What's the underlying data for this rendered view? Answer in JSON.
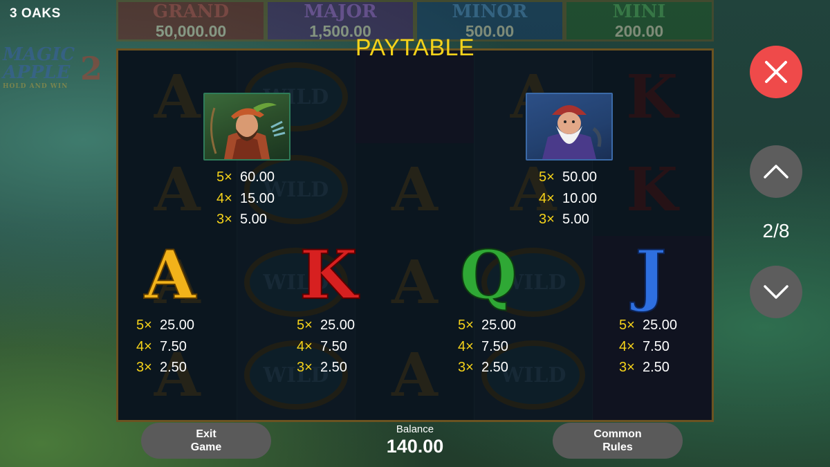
{
  "brand": "3 OAKS",
  "logo": {
    "line1": "MAGIC",
    "line2": "APPLE",
    "number": "2",
    "tagline": "HOLD AND WIN"
  },
  "jackpots": [
    {
      "name": "GRAND",
      "value": "50,000.00"
    },
    {
      "name": "MAJOR",
      "value": "1,500.00"
    },
    {
      "name": "MINOR",
      "value": "500.00"
    },
    {
      "name": "MINI",
      "value": "200.00"
    }
  ],
  "paytable": {
    "title": "PAYTABLE",
    "hunter": {
      "icon": "hunter-symbol-icon",
      "pays": [
        {
          "mult": "5×",
          "val": "60.00"
        },
        {
          "mult": "4×",
          "val": "15.00"
        },
        {
          "mult": "3×",
          "val": "5.00"
        }
      ]
    },
    "gnome": {
      "icon": "gnome-symbol-icon",
      "pays": [
        {
          "mult": "5×",
          "val": "50.00"
        },
        {
          "mult": "4×",
          "val": "10.00"
        },
        {
          "mult": "3×",
          "val": "5.00"
        }
      ]
    },
    "A": {
      "letter": "A",
      "pays": [
        {
          "mult": "5×",
          "val": "25.00"
        },
        {
          "mult": "4×",
          "val": "7.50"
        },
        {
          "mult": "3×",
          "val": "2.50"
        }
      ]
    },
    "K": {
      "letter": "K",
      "pays": [
        {
          "mult": "5×",
          "val": "25.00"
        },
        {
          "mult": "4×",
          "val": "7.50"
        },
        {
          "mult": "3×",
          "val": "2.50"
        }
      ]
    },
    "Q": {
      "letter": "Q",
      "pays": [
        {
          "mult": "5×",
          "val": "25.00"
        },
        {
          "mult": "4×",
          "val": "7.50"
        },
        {
          "mult": "3×",
          "val": "2.50"
        }
      ]
    },
    "J": {
      "letter": "J",
      "pays": [
        {
          "mult": "5×",
          "val": "25.00"
        },
        {
          "mult": "4×",
          "val": "7.50"
        },
        {
          "mult": "3×",
          "val": "2.50"
        }
      ]
    }
  },
  "nav": {
    "close_icon": "close-icon",
    "up_icon": "chevron-up-icon",
    "down_icon": "chevron-down-icon",
    "page": "2/8"
  },
  "bottom": {
    "exit_line1": "Exit",
    "exit_line2": "Game",
    "balance_label": "Balance",
    "balance_value": "140.00",
    "rules_line1": "Common",
    "rules_line2": "Rules"
  },
  "colors": {
    "title": "#f5d21a",
    "multiplier": "#f5d21a",
    "close_button": "#ef4a4a",
    "nav_button": "#5d5d5d",
    "pill_button": "#5a5a5a"
  }
}
